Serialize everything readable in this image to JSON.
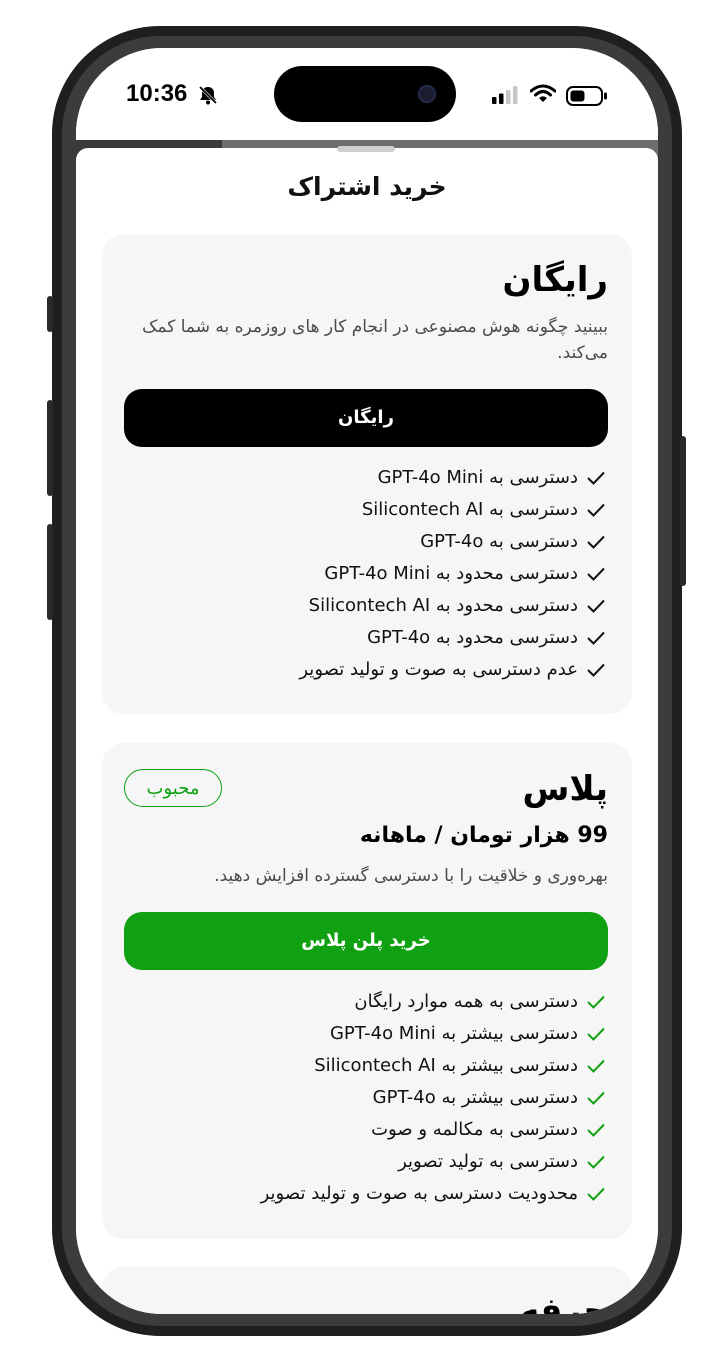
{
  "status_bar": {
    "time": "10:36"
  },
  "sheet": {
    "title": "خرید اشتراک",
    "plans": [
      {
        "name": "رایگان",
        "description": "ببینید چگونه هوش مصنوعی در انجام کار های روزمره به شما کمک می‌کند.",
        "button_label": "رایگان",
        "features": [
          "دسترسی به GPT-4o Mini",
          "دسترسی به Silicontech AI",
          "دسترسی به GPT-4o",
          "دسترسی محدود به GPT-4o Mini",
          "دسترسی محدود به Silicontech AI",
          "دسترسی محدود به GPT-4o",
          "عدم دسترسی به صوت و تولید تصویر"
        ]
      },
      {
        "name": "پلاس",
        "badge": "محبوب",
        "price": "99 هزار تومان / ماهانه",
        "description": "بهره‌وری و خلاقیت را با دسترسی گسترده افزایش دهید.",
        "button_label": "خرید پلن پلاس",
        "features": [
          "دسترسی به همه موارد رایگان",
          "دسترسی بیشتر به GPT-4o Mini",
          "دسترسی بیشتر به Silicontech AI",
          "دسترسی بیشتر به GPT-4o",
          "دسترسی به مکالمه و صوت",
          "دسترسی به تولید تصویر",
          "محدودیت دسترسی به صوت و تولید تصویر"
        ]
      }
    ],
    "next_plan_partial_title": "حرفه"
  },
  "colors": {
    "accent_green": "#10a112",
    "black_button": "#000000",
    "card_bg": "#f6f6f6"
  }
}
